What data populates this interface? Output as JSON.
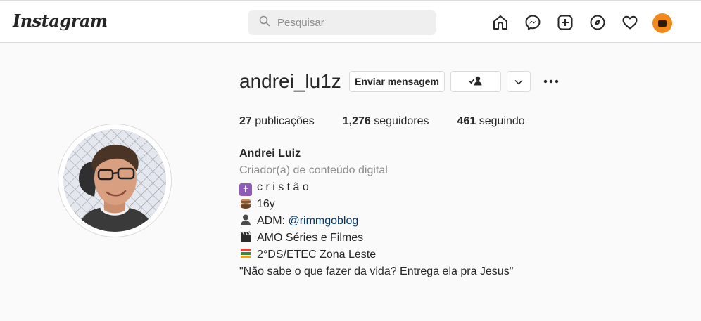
{
  "topbar": {
    "logo": "Instagram",
    "search_placeholder": "Pesquisar",
    "icons": [
      "home-icon",
      "messenger-icon",
      "new-post-icon",
      "explore-icon",
      "activity-heart-icon",
      "profile-avatar-icon"
    ]
  },
  "profile": {
    "username": "andrei_lu1z",
    "message_button": "Enviar mensagem",
    "stats": {
      "posts_count": "27",
      "posts_label": "publicações",
      "followers_count": "1,276",
      "followers_label": "seguidores",
      "following_count": "461",
      "following_label": "seguindo"
    },
    "bio": {
      "name": "Andrei Luiz",
      "category": "Criador(a) de conteúdo digital",
      "line1": "c r i s t ã o",
      "line2": "16y",
      "line3_prefix": "ADM: ",
      "line3_mention": "@rimmgoblog",
      "line4": "AMO Séries e Filmes",
      "line5": "2°DS/ETEC Zona Leste",
      "quote": "\"Não sabe o que fazer da vida? Entrega ela pra Jesus\""
    }
  },
  "colors": {
    "accent_link": "#00376b",
    "muted": "#8e8e8e",
    "border": "#dbdbdb",
    "avatar_orange": "#f08a1c"
  }
}
